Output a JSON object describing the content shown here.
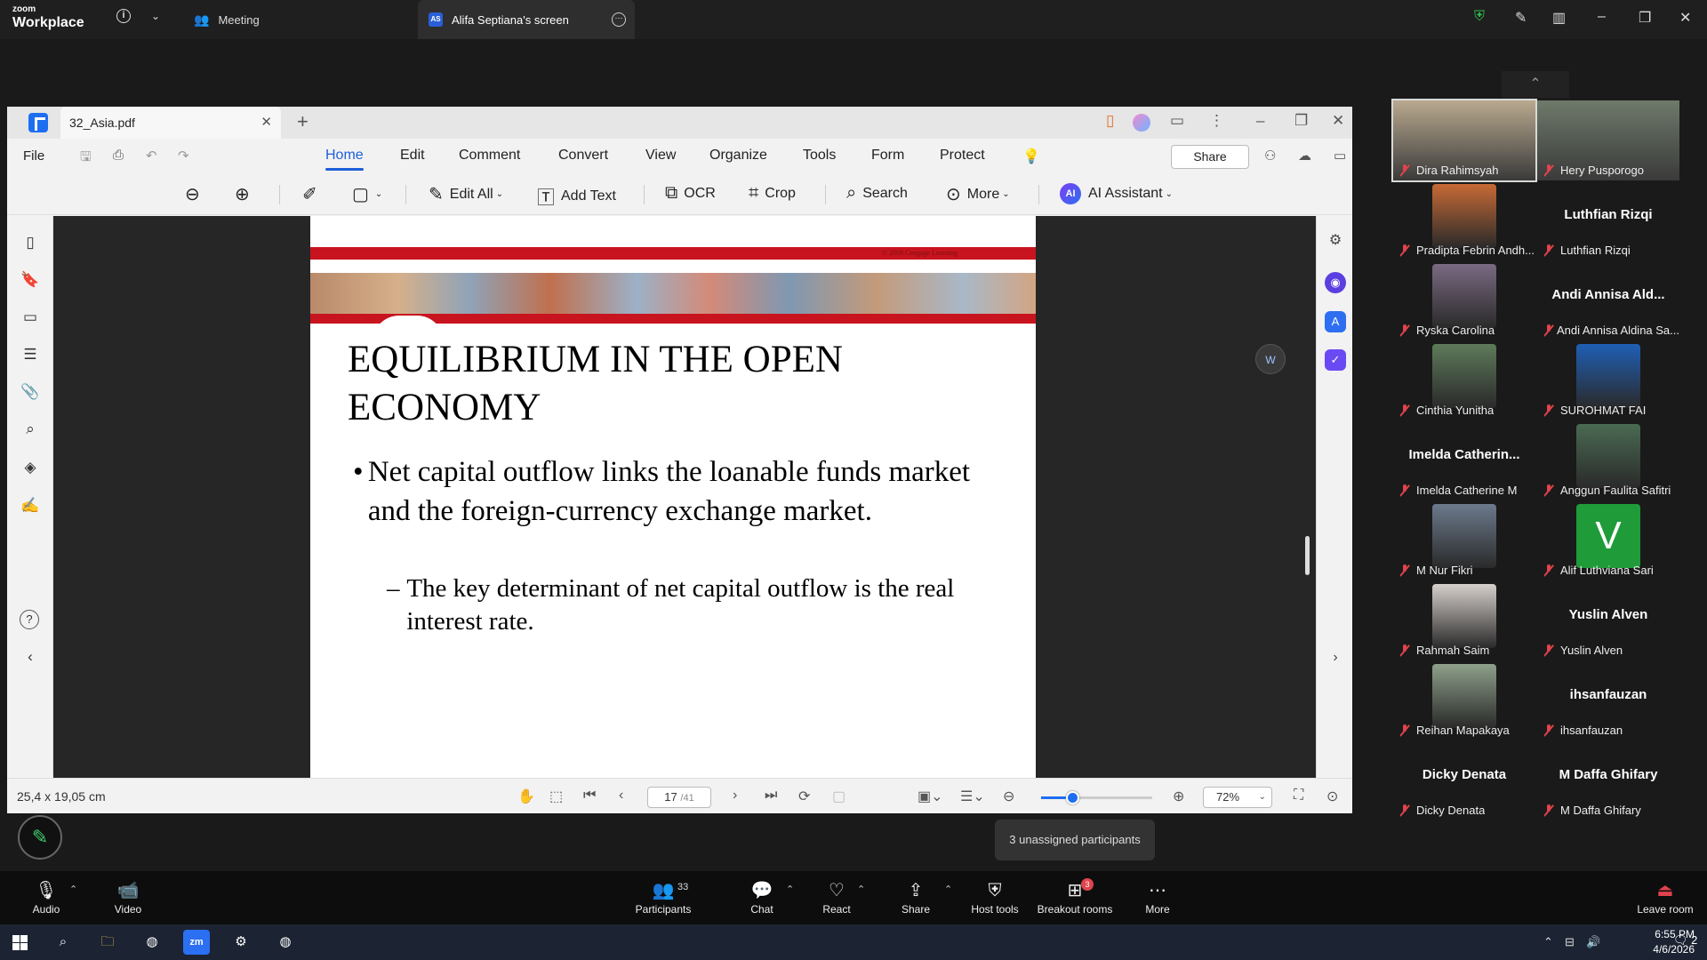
{
  "zoom": {
    "logo_line1": "zoom",
    "logo_line2": "Workplace",
    "meeting_tab": "Meeting",
    "share_tab_badge": "AS",
    "share_tab": "Alifa Septiana's screen"
  },
  "pdf": {
    "doc_tab": "32_Asia.pdf",
    "menu": {
      "file": "File",
      "items": [
        "Home",
        "Edit",
        "Comment",
        "Convert",
        "View",
        "Organize",
        "Tools",
        "Form",
        "Protect"
      ],
      "share": "Share"
    },
    "toolbar": {
      "edit_all": "Edit All",
      "add_text": "Add Text",
      "ocr": "OCR",
      "crop": "Crop",
      "search": "Search",
      "more": "More",
      "ai_badge": "AI",
      "ai_assistant": "AI Assistant"
    },
    "slide": {
      "copyright": "© 2008 Cengage Learning",
      "title": "EQUILIBRIUM IN THE OPEN ECONOMY",
      "bullet": "Net capital outflow links the loanable funds market and the foreign-currency exchange market.",
      "sub_bullet": "The key determinant of net capital outflow is the real interest rate."
    },
    "status": {
      "dimensions": "25,4 x 19,05 cm",
      "page_current": "17",
      "page_total": "/41",
      "zoom_level": "72%",
      "zoom_fraction": 0.28
    }
  },
  "tooltip": "3 unassigned participants",
  "participants": [
    {
      "name": "Dira Rahimsyah",
      "type": "video",
      "muted": true,
      "color": "#b9a98f",
      "active": true
    },
    {
      "name": "Hery Pusporogo",
      "type": "video",
      "muted": true,
      "color": "#6e7a6a"
    },
    {
      "name": "Pradipta Febrin Andh...",
      "type": "thumb",
      "muted": true,
      "color": "#c76a35"
    },
    {
      "name": "Luthfian Rizqi",
      "type": "name",
      "muted": true,
      "display": "Luthfian Rizqi"
    },
    {
      "name": "Ryska Carolina",
      "type": "thumb",
      "muted": true,
      "color": "#7a6a82"
    },
    {
      "name": "Andi Annisa Aldina Sa...",
      "type": "name",
      "muted": true,
      "display": "Andi Annisa Ald..."
    },
    {
      "name": "Cinthia Yunitha",
      "type": "thumb",
      "muted": true,
      "color": "#5e7a5a"
    },
    {
      "name": "SUROHMAT FAI",
      "type": "thumb",
      "muted": true,
      "color": "#1f5fb5"
    },
    {
      "name": "Imelda Catherine M",
      "type": "name",
      "muted": true,
      "display": "Imelda  Catherin..."
    },
    {
      "name": "Anggun Faulita Safitri",
      "type": "thumb",
      "muted": true,
      "color": "#4a6a52"
    },
    {
      "name": "M Nur Fikri",
      "type": "thumb",
      "muted": true,
      "color": "#6c7a8c"
    },
    {
      "name": "Alif Luthviana Sari",
      "type": "avatar",
      "muted": true,
      "letter": "V"
    },
    {
      "name": "Rahmah Saim",
      "type": "thumb",
      "muted": true,
      "color": "#d6d0cc"
    },
    {
      "name": "Yuslin Alven",
      "type": "name",
      "muted": true,
      "display": "Yuslin Alven"
    },
    {
      "name": "Reihan Mapakaya",
      "type": "thumb",
      "muted": true,
      "color": "#8ea08a"
    },
    {
      "name": "ihsanfauzan",
      "type": "name",
      "muted": true,
      "display": "ihsanfauzan"
    },
    {
      "name": "Dicky Denata",
      "type": "name",
      "muted": true,
      "display": "Dicky Denata"
    },
    {
      "name": "M Daffa Ghifary",
      "type": "name",
      "muted": true,
      "display": "M Daffa Ghifary"
    }
  ],
  "controls": {
    "audio": "Audio",
    "video": "Video",
    "participants": "Participants",
    "participants_count": "33",
    "chat": "Chat",
    "react": "React",
    "share": "Share",
    "host_tools": "Host tools",
    "breakout_rooms": "Breakout rooms",
    "breakout_badge": "3",
    "more": "More",
    "leave": "Leave room"
  },
  "taskbar": {
    "time": "6:55 PM",
    "date": "4/6/2026",
    "notifications": "2"
  },
  "colors": {
    "accent": "#1e5fd9",
    "slide_red": "#c8141e",
    "zoom_green": "#1f9b3a",
    "muted_red": "#e0434d"
  }
}
